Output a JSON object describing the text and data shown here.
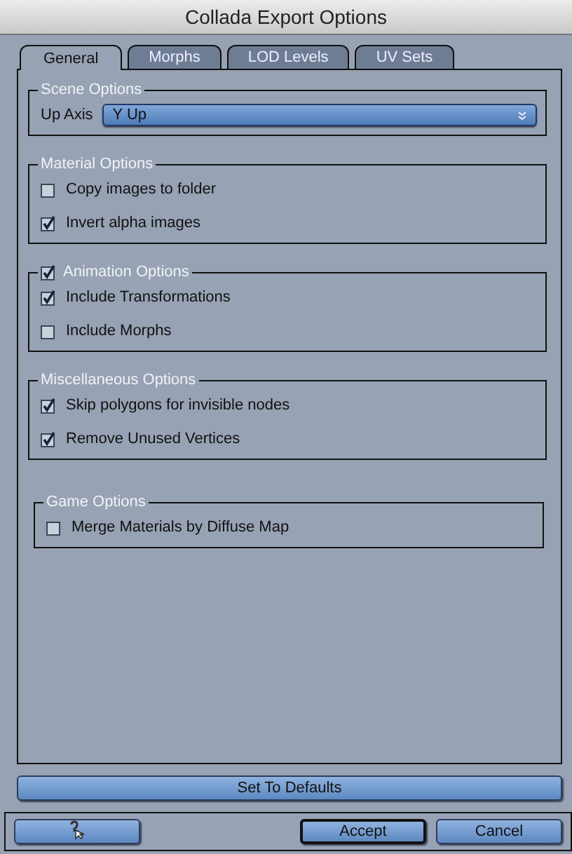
{
  "window": {
    "title": "Collada Export Options"
  },
  "tabs": [
    {
      "label": "General",
      "selected": true
    },
    {
      "label": "Morphs",
      "selected": false
    },
    {
      "label": "LOD Levels",
      "selected": false
    },
    {
      "label": "UV Sets",
      "selected": false
    }
  ],
  "groups": [
    {
      "title": "Scene Options",
      "items": [
        {
          "kind": "select",
          "label": "Up Axis",
          "value": "Y Up"
        }
      ]
    },
    {
      "title": "Material Options",
      "items": [
        {
          "kind": "checkbox",
          "label": "Copy images to folder",
          "checked": false
        },
        {
          "kind": "checkbox",
          "label": "Invert alpha images",
          "checked": true
        }
      ]
    },
    {
      "title": "Animation Options",
      "checked": true,
      "items": [
        {
          "kind": "checkbox",
          "label": "Include Transformations",
          "checked": true
        },
        {
          "kind": "checkbox",
          "label": "Include Morphs",
          "checked": false
        }
      ]
    },
    {
      "title": "Miscellaneous Options",
      "items": [
        {
          "kind": "checkbox",
          "label": "Skip polygons for invisible nodes",
          "checked": true
        },
        {
          "kind": "checkbox",
          "label": "Remove Unused Vertices",
          "checked": true
        }
      ]
    },
    {
      "title": "Game Options",
      "items": [
        {
          "kind": "checkbox",
          "label": "Merge Materials by Diffuse Map",
          "checked": false
        }
      ]
    }
  ],
  "defaults_button": "Set To Defaults",
  "footer": [
    {
      "kind": "icon"
    },
    {
      "kind": "default",
      "label": "Accept"
    },
    {
      "kind": "normal",
      "label": "Cancel"
    }
  ]
}
